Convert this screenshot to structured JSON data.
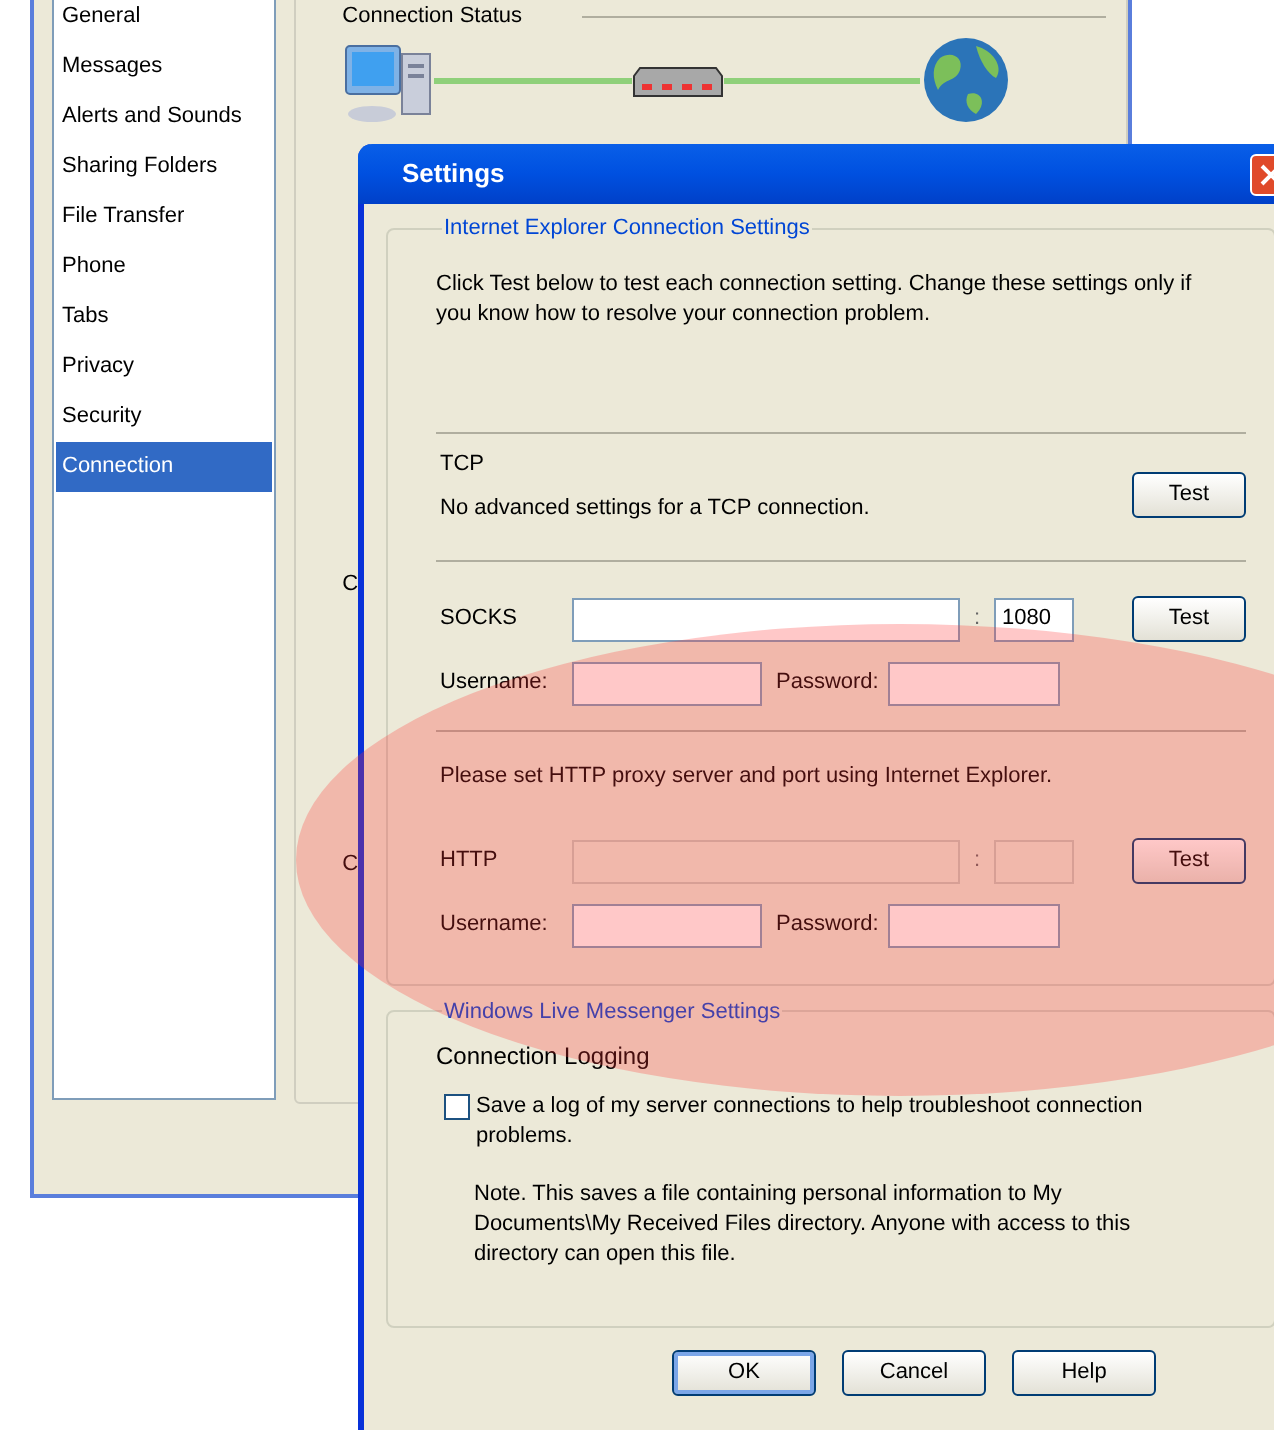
{
  "background_window": {
    "sidebar_items": [
      {
        "label": "General",
        "selected": false
      },
      {
        "label": "Messages",
        "selected": false
      },
      {
        "label": "Alerts and Sounds",
        "selected": false
      },
      {
        "label": "Sharing Folders",
        "selected": false
      },
      {
        "label": "File Transfer",
        "selected": false
      },
      {
        "label": "Phone",
        "selected": false
      },
      {
        "label": "Tabs",
        "selected": false
      },
      {
        "label": "Privacy",
        "selected": false
      },
      {
        "label": "Security",
        "selected": false
      },
      {
        "label": "Connection",
        "selected": true
      }
    ],
    "section_title": "Connection Status",
    "cut_labels": [
      "C",
      "C"
    ]
  },
  "dialog": {
    "title": "Settings",
    "ie_group": {
      "title": "Internet Explorer Connection Settings",
      "intro": "Click Test below to test each connection setting. Change these settings only if you know how to resolve your connection problem.",
      "tcp": {
        "label": "TCP",
        "note": "No advanced settings for a TCP connection.",
        "button": "Test"
      },
      "socks": {
        "label": "SOCKS",
        "separator": ":",
        "port": "1080",
        "username_label": "Username:",
        "password_label": "Password:",
        "button": "Test",
        "disabled": false
      },
      "http_note": "Please set HTTP proxy server and port using Internet Explorer.",
      "http": {
        "label": "HTTP",
        "separator": ":",
        "username_label": "Username:",
        "password_label": "Password:",
        "button": "Test",
        "disabled": true
      }
    },
    "wlm_group": {
      "title": "Windows Live Messenger Settings",
      "subtitle": "Connection Logging",
      "checkbox": {
        "label": "Save a log of my server connections to help troubleshoot connection problems.",
        "checked": false
      },
      "note": "Note. This saves a file containing personal information to My Documents\\My Received Files directory. Anyone with access to this directory can open this file."
    },
    "buttons": [
      {
        "label": "OK",
        "default": true
      },
      {
        "label": "Cancel",
        "default": false
      },
      {
        "label": "Help",
        "default": false
      }
    ]
  }
}
